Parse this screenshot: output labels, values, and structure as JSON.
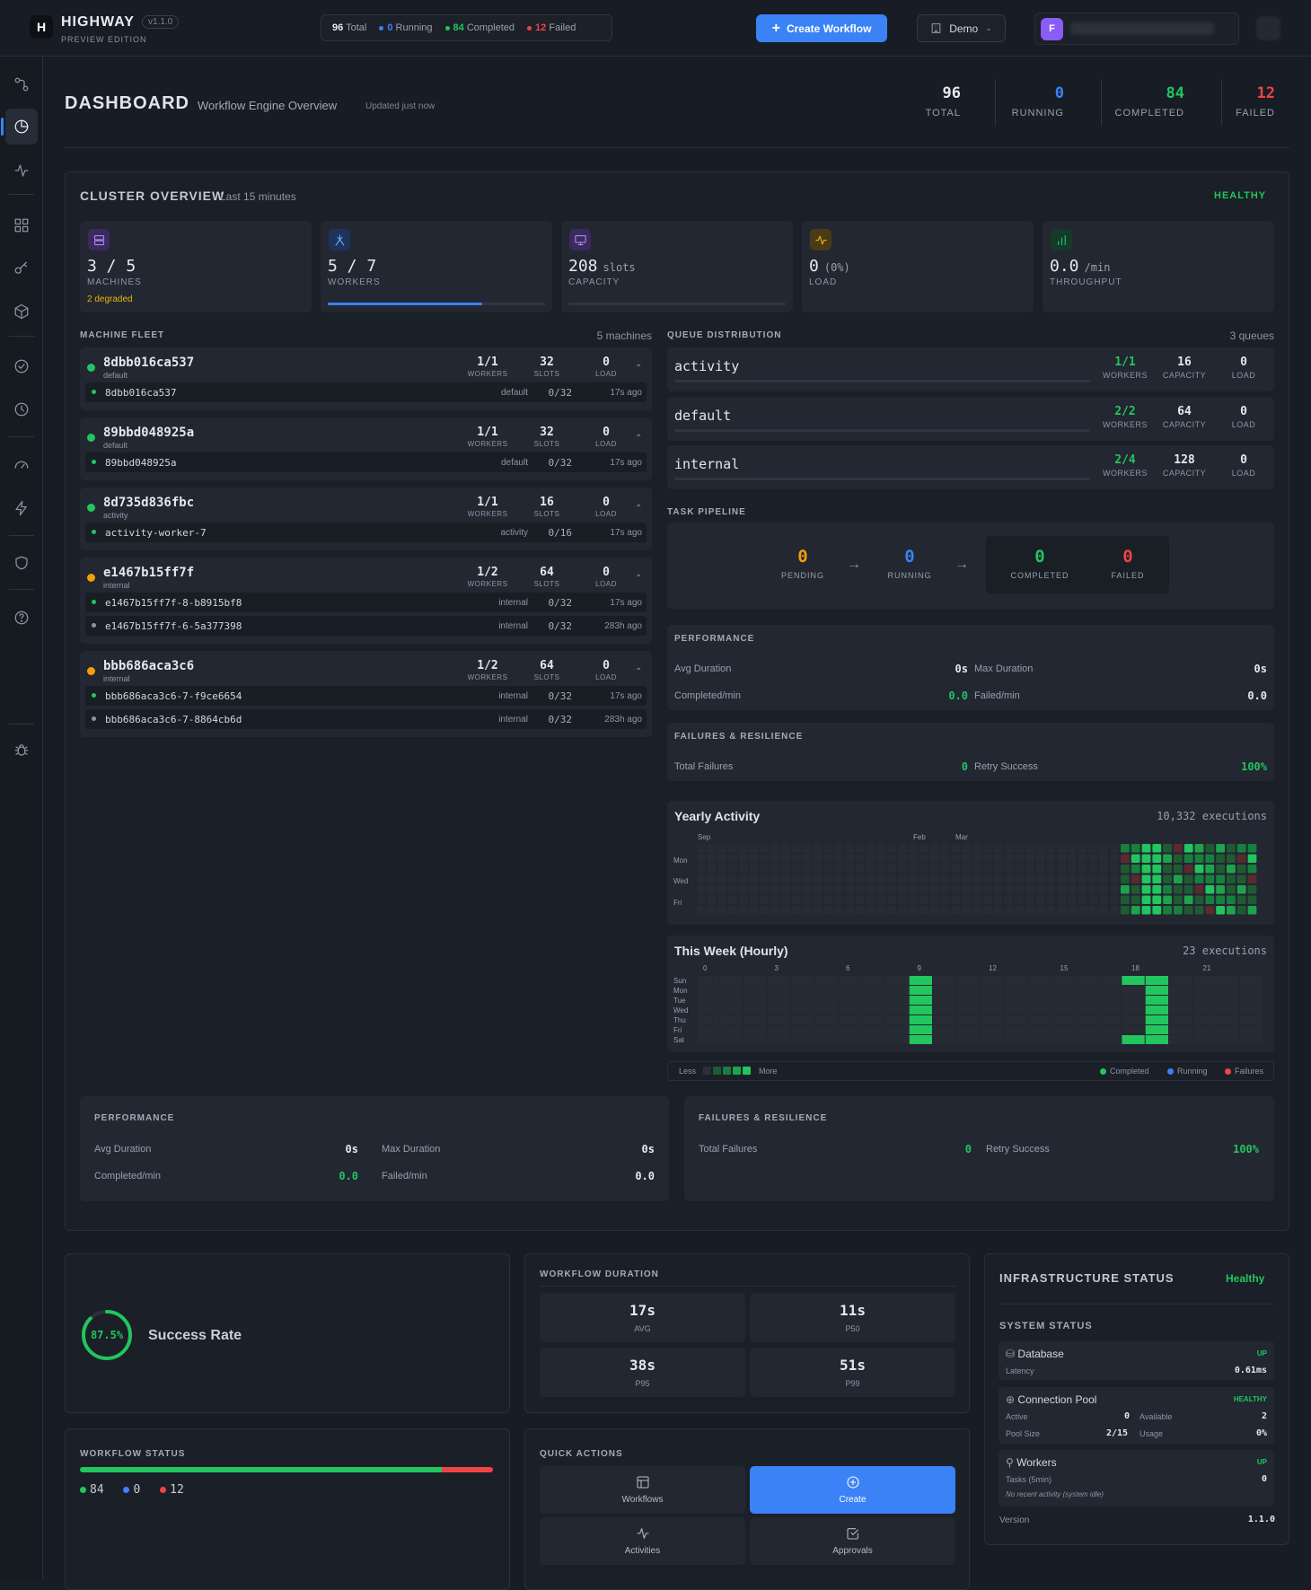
{
  "app": {
    "name": "HIGHWAY",
    "version": "v1.1.0",
    "edition": "PREVIEW EDITION"
  },
  "status_summary": {
    "total": "96",
    "total_label": "Total",
    "running": "0",
    "running_label": "Running",
    "completed": "84",
    "completed_label": "Completed",
    "failed": "12",
    "failed_label": "Failed"
  },
  "toolbar": {
    "create_label": "Create Workflow",
    "workspace": "Demo",
    "avatar_initial": "F"
  },
  "colors": {
    "accent": "#3b82f6",
    "success": "#22c55e",
    "running": "#3b82f6",
    "failed": "#ef4444",
    "warning": "#eab308",
    "pending": "#f59e0b"
  },
  "sidebar_icons": [
    "workflows-icon",
    "dashboard-icon",
    "activity-icon",
    "grid-icon",
    "key-icon",
    "package-icon",
    "check-circle-icon",
    "clock-icon",
    "gauge-icon",
    "bolt-icon",
    "shield-icon",
    "help-icon",
    "bug-icon"
  ],
  "dashboard": {
    "title": "DASHBOARD",
    "subtitle": "Workflow Engine Overview",
    "updated": "Updated just now",
    "kpis": [
      {
        "value": "96",
        "label": "TOTAL"
      },
      {
        "value": "0",
        "label": "RUNNING"
      },
      {
        "value": "84",
        "label": "COMPLETED"
      },
      {
        "value": "12",
        "label": "FAILED"
      }
    ]
  },
  "cluster": {
    "title": "CLUSTER OVERVIEW",
    "subtitle": "Last 15 minutes",
    "health": "HEALTHY",
    "stats": [
      {
        "value": "3 / 5",
        "unit": "",
        "label": "MACHINES",
        "extra": "2 degraded",
        "icon": "server-icon"
      },
      {
        "value": "5 / 7",
        "unit": "",
        "label": "WORKERS",
        "progress": 0.71,
        "icon": "workers-icon"
      },
      {
        "value": "208",
        "unit": "slots",
        "label": "CAPACITY",
        "progress": 0,
        "icon": "monitor-icon"
      },
      {
        "value": "0",
        "unit": "(0%)",
        "label": "LOAD",
        "icon": "pulse-icon"
      },
      {
        "value": "0.0",
        "unit": "/min",
        "label": "THROUGHPUT",
        "icon": "bars-icon"
      }
    ],
    "fleet": {
      "title": "MACHINE FLEET",
      "count": "5 machines",
      "col_workers": "WORKERS",
      "col_slots": "SLOTS",
      "col_load": "LOAD",
      "machines": [
        {
          "name": "8dbb016ca537",
          "queue": "default",
          "workers": "1/1",
          "slots": "32",
          "load": "0",
          "status": "healthy",
          "workers_list": [
            {
              "name": "8dbb016ca537",
              "queue": "default",
              "cap": "0/32",
              "ago": "17s ago",
              "status": "active"
            }
          ]
        },
        {
          "name": "89bbd048925a",
          "queue": "default",
          "workers": "1/1",
          "slots": "32",
          "load": "0",
          "status": "healthy",
          "workers_list": [
            {
              "name": "89bbd048925a",
              "queue": "default",
              "cap": "0/32",
              "ago": "17s ago",
              "status": "active"
            }
          ]
        },
        {
          "name": "8d735d836fbc",
          "queue": "activity",
          "workers": "1/1",
          "slots": "16",
          "load": "0",
          "status": "healthy",
          "workers_list": [
            {
              "name": "activity-worker-7",
              "queue": "activity",
              "cap": "0/16",
              "ago": "17s ago",
              "status": "active"
            }
          ]
        },
        {
          "name": "e1467b15ff7f",
          "queue": "internal",
          "workers": "1/2",
          "slots": "64",
          "load": "0",
          "status": "degraded",
          "workers_list": [
            {
              "name": "e1467b15ff7f-8-b8915bf8",
              "queue": "internal",
              "cap": "0/32",
              "ago": "17s ago",
              "status": "active"
            },
            {
              "name": "e1467b15ff7f-6-5a377398",
              "queue": "internal",
              "cap": "0/32",
              "ago": "283h ago",
              "status": "stale"
            }
          ]
        },
        {
          "name": "bbb686aca3c6",
          "queue": "internal",
          "workers": "1/2",
          "slots": "64",
          "load": "0",
          "status": "degraded",
          "workers_list": [
            {
              "name": "bbb686aca3c6-7-f9ce6654",
              "queue": "internal",
              "cap": "0/32",
              "ago": "17s ago",
              "status": "active"
            },
            {
              "name": "bbb686aca3c6-7-8864cb6d",
              "queue": "internal",
              "cap": "0/32",
              "ago": "283h ago",
              "status": "stale"
            }
          ]
        }
      ]
    },
    "queues": {
      "title": "QUEUE DISTRIBUTION",
      "count": "3 queues",
      "col_workers": "WORKERS",
      "col_capacity": "CAPACITY",
      "col_load": "LOAD",
      "items": [
        {
          "name": "activity",
          "workers": "1/1",
          "capacity": "16",
          "load": "0"
        },
        {
          "name": "default",
          "workers": "2/2",
          "capacity": "64",
          "load": "0"
        },
        {
          "name": "internal",
          "workers": "2/4",
          "capacity": "128",
          "load": "0"
        }
      ]
    },
    "pipeline": {
      "title": "TASK PIPELINE",
      "stages": [
        {
          "value": "0",
          "label": "PENDING"
        },
        {
          "value": "0",
          "label": "RUNNING"
        },
        {
          "value": "0",
          "label": "COMPLETED"
        },
        {
          "value": "0",
          "label": "FAILED"
        }
      ]
    },
    "performance": {
      "title": "PERFORMANCE",
      "avg_label": "Avg Duration",
      "avg": "0s",
      "max_label": "Max Duration",
      "max": "0s",
      "cpm_label": "Completed/min",
      "cpm": "0.0",
      "fpm_label": "Failed/min",
      "fpm": "0.0"
    },
    "failures": {
      "title": "FAILURES & RESILIENCE",
      "total_label": "Total Failures",
      "total": "0",
      "retry_label": "Retry Success",
      "retry": "100%"
    },
    "yearly": {
      "title": "Yearly Activity",
      "count": "10,332 executions",
      "months": [
        "Sep",
        "Feb",
        "Mar"
      ],
      "days": [
        "Mon",
        "Wed",
        "Fri"
      ]
    },
    "weekly": {
      "title": "This Week (Hourly)",
      "count": "23 executions",
      "hours": [
        "0",
        "3",
        "6",
        "9",
        "12",
        "15",
        "18",
        "21"
      ],
      "days": [
        "Sun",
        "Mon",
        "Tue",
        "Wed",
        "Thu",
        "Fri",
        "Sat"
      ]
    },
    "legend": {
      "less": "Less",
      "more": "More",
      "completed": "Completed",
      "running": "Running",
      "failures": "Failures"
    }
  },
  "success": {
    "value": "87.5%",
    "fraction": 0.875,
    "label": "Success Rate"
  },
  "duration": {
    "title": "WORKFLOW DURATION",
    "items": [
      {
        "value": "17s",
        "label": "AVG"
      },
      {
        "value": "11s",
        "label": "P50"
      },
      {
        "value": "38s",
        "label": "P95"
      },
      {
        "value": "51s",
        "label": "P99"
      }
    ]
  },
  "wf_status": {
    "title": "WORKFLOW STATUS",
    "completed": "84",
    "running": "0",
    "failed": "12"
  },
  "quick_actions": {
    "title": "QUICK ACTIONS",
    "items": [
      {
        "label": "Workflows",
        "icon": "table-icon"
      },
      {
        "label": "Create",
        "icon": "plus-circle-icon"
      },
      {
        "label": "Activities",
        "icon": "activity-icon"
      },
      {
        "label": "Approvals",
        "icon": "check-square-icon"
      }
    ]
  },
  "infra": {
    "title": "INFRASTRUCTURE STATUS",
    "health": "Healthy",
    "system_label": "SYSTEM STATUS",
    "database": {
      "name": "Database",
      "status": "UP",
      "latency_label": "Latency",
      "latency": "0.61ms"
    },
    "pool": {
      "name": "Connection Pool",
      "status": "HEALTHY",
      "active_label": "Active",
      "active": "0",
      "available_label": "Available",
      "available": "2",
      "size_label": "Pool Size",
      "size": "2/15",
      "usage_label": "Usage",
      "usage": "0%"
    },
    "workers": {
      "name": "Workers",
      "status": "UP",
      "tasks_label": "Tasks (5min)",
      "tasks": "0",
      "note": "No recent activity (system idle)"
    },
    "version_label": "Version",
    "version": "1.1.0"
  }
}
